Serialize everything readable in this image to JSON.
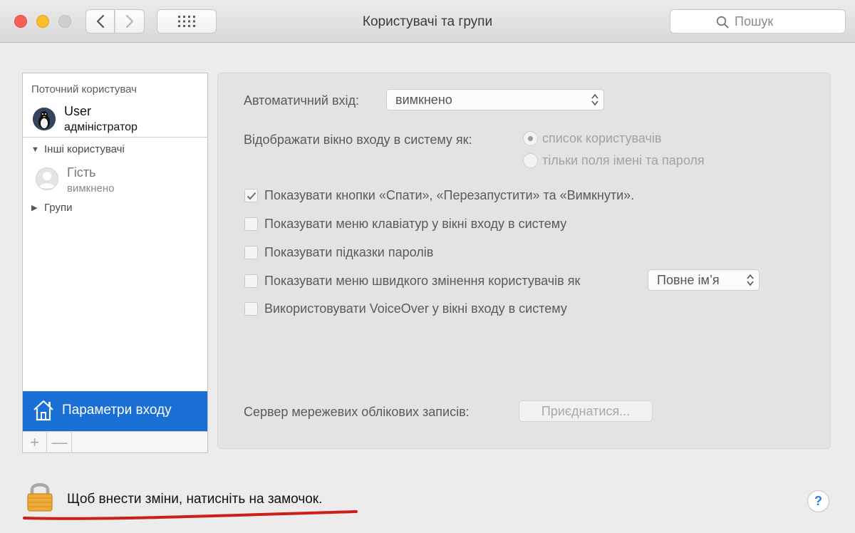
{
  "window": {
    "title": "Користувачі та групи",
    "search_placeholder": "Пошук"
  },
  "sidebar": {
    "current_user_label": "Поточний користувач",
    "current_user": {
      "name": "User",
      "role": "адміністратор"
    },
    "other_users_label": "Інші користувачі",
    "guest": {
      "name": "Гість",
      "status": "вимкнено"
    },
    "groups_label": "Групи",
    "login_options_label": "Параметри входу",
    "add_label": "+",
    "remove_label": "—"
  },
  "content": {
    "auto_login_label": "Автоматичний вхід:",
    "auto_login_value": "вимкнено",
    "display_login_label": "Відображати вікно входу в систему як:",
    "display_options": [
      {
        "label": "список користувачів",
        "selected": true
      },
      {
        "label": "тільки поля імені та пароля",
        "selected": false
      }
    ],
    "checkboxes": [
      {
        "label": "Показувати кнопки «Спати», «Перезапустити» та «Вимкнути».",
        "checked": true
      },
      {
        "label": "Показувати меню клавіатур у вікні входу в систему",
        "checked": false
      },
      {
        "label": "Показувати підказки паролів",
        "checked": false
      },
      {
        "label": "Показувати меню швидкого змінення користувачів як",
        "checked": false
      },
      {
        "label": "Використовувати VoiceOver у вікні входу в систему",
        "checked": false
      }
    ],
    "fast_switch_value": "Повне ім’я",
    "network_server_label": "Сервер мережевих облікових записів:",
    "join_button": "Приєднатися..."
  },
  "footer": {
    "lock_text": "Щоб внести зміни, натисніть на замочок.",
    "help_label": "?"
  },
  "colors": {
    "selection_blue": "#1a6fd5",
    "annotation_red": "#cc1f1a"
  }
}
